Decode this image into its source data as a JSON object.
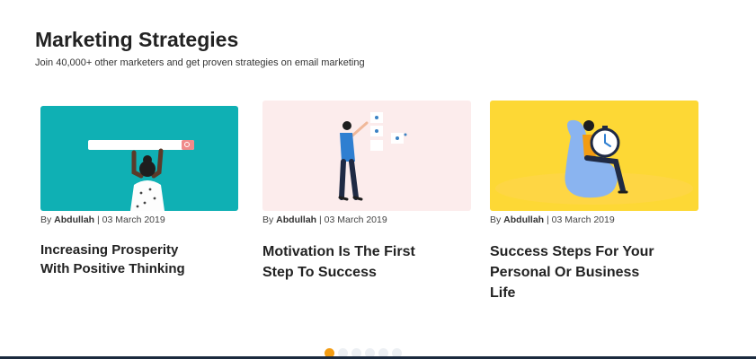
{
  "header": {
    "title": "Marketing Strategies",
    "subtitle": "Join 40,000+ other marketers and get proven strategies on email marketing"
  },
  "cards": [
    {
      "author_prefix": "By ",
      "author": "Abdullah",
      "date": " | 03 March 2019",
      "title": "Increasing Prosperity With Positive Thinking",
      "image_bg": "#0fb0b4"
    },
    {
      "author_prefix": "By ",
      "author": "Abdullah",
      "date": " | 03 March 2019",
      "title": "Motivation Is The First Step To Success",
      "image_bg": "#fcecec"
    },
    {
      "author_prefix": "By ",
      "author": "Abdullah",
      "date": " | 03 March 2019",
      "title": "Success Steps For Your Personal Or Business Life",
      "image_bg": "#fdd835"
    }
  ],
  "carousel": {
    "total_dots": 6,
    "active_index": 0,
    "active_color": "#f39c12",
    "inactive_color": "#eceff3"
  }
}
